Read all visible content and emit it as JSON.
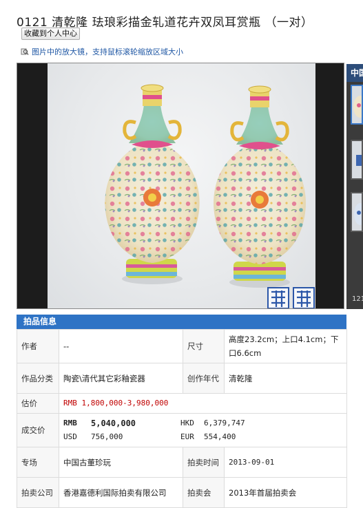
{
  "page": {
    "title": "0121 清乾隆 珐琅彩描金轧道花卉双凤耳赏瓶 （一对）",
    "favorite_label": "收藏到个人中心",
    "zoom_hint": "图片中的放大镜，支持鼠标滚轮缩放区域大小"
  },
  "side_panel": {
    "tab_label": "中国",
    "counter": "121"
  },
  "info": {
    "header": "拍品信息",
    "author_label": "作者",
    "author_value": "--",
    "size_label": "尺寸",
    "size_value": "高度23.2cm；上口4.1cm；下口6.6cm",
    "category_label": "作品分类",
    "category_value": "陶瓷\\清代其它彩釉瓷器",
    "era_label": "创作年代",
    "era_value": "清乾隆",
    "estimate_label": "估价",
    "estimate_value": "RMB  1,800,000-3,980,000",
    "deal_label": "成交价",
    "deal_rmb_cur": "RMB",
    "deal_rmb_val": "5,040,000",
    "deal_hkd_cur": "HKD",
    "deal_hkd_val": "6,379,747",
    "deal_usd_cur": "USD",
    "deal_usd_val": "756,000",
    "deal_eur_cur": "EUR",
    "deal_eur_val": "554,400",
    "session_label": "专场",
    "session_value": "中国古董珍玩",
    "date_label": "拍卖时间",
    "date_value": "2013-09-01",
    "company_label": "拍卖公司",
    "company_value": "香港嘉德利国际拍卖有限公司",
    "sale_label": "拍卖会",
    "sale_value": "2013年首届拍卖会"
  },
  "colors": {
    "accent": "#2e73c5",
    "link": "#1f57a4",
    "estimate_red": "#c00000"
  }
}
